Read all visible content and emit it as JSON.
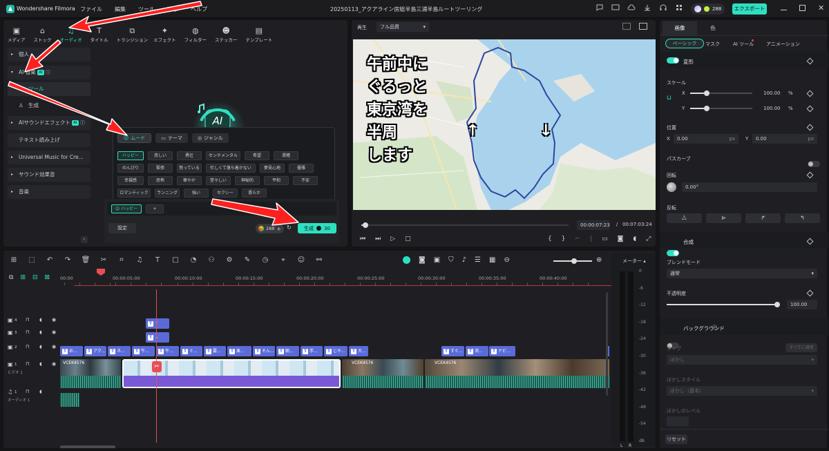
{
  "app": {
    "name": "Wondershare Filmora",
    "project_title": "20250113_アクアライン房総半島三浦半島ルートツーリング"
  },
  "menu": [
    "ファイル",
    "編集",
    "ツール",
    "表示",
    "ヘルプ"
  ],
  "topright": {
    "credits": "288",
    "export_label": "エクスポート"
  },
  "media_tabs": [
    {
      "label": "メディア",
      "icon": "media-icon"
    },
    {
      "label": "ストック",
      "icon": "stock-icon"
    },
    {
      "label": "オーディオ",
      "icon": "audio-note-icon"
    },
    {
      "label": "タイトル",
      "icon": "title-icon"
    },
    {
      "label": "トランジション",
      "icon": "transition-icon"
    },
    {
      "label": "エフェクト",
      "icon": "effect-icon"
    },
    {
      "label": "フィルター",
      "icon": "filter-icon"
    },
    {
      "label": "ステッカー",
      "icon": "sticker-icon"
    },
    {
      "label": "テンプレート",
      "icon": "template-icon"
    }
  ],
  "sidebar": {
    "personal": "個人",
    "ai_music": "AI 音楽",
    "ai_badge": "AI",
    "tool": "ツール",
    "generate": "生成",
    "ai_sound": "AIサウンドエフェクト",
    "tts": "テキスト読み上げ",
    "universal": "Universal Music for Cre...",
    "sound_fx": "サウンド効果音",
    "music": "音楽"
  },
  "ai_panel": {
    "tabs": [
      "ムード",
      "テーマ",
      "ジャンル"
    ],
    "moods": [
      [
        "ハッピー",
        "悲しい",
        "勇壮",
        "センチメンタル",
        "希望",
        "滑稽"
      ],
      [
        "のんびり",
        "緊張",
        "怒っている",
        "忙しくて落ち着かない",
        "夢見心地",
        "優雅"
      ],
      [
        "幸福感",
        "恐怖",
        "華やか",
        "堂々しい",
        "神秘的",
        "平和",
        "不安"
      ],
      [
        "ロマンティック",
        "ランニング",
        "強い",
        "セクシー",
        "滑らか"
      ]
    ],
    "selected_tag": "ハッピー",
    "add": "+",
    "settings": "設定",
    "credits": "288",
    "generate": "生成",
    "cost": "30"
  },
  "preview": {
    "label": "再生",
    "quality": "フル品質",
    "overlay_lines": [
      "午前中に",
      "ぐるっと",
      "東京湾を",
      "半周",
      "します"
    ],
    "arrow_up": "↑",
    "arrow_down": "↓",
    "current_time": "00:00:07:23",
    "total_time": "00:07:03:24",
    "separator": "/",
    "progress_fraction": 0.019
  },
  "inspector": {
    "tabs": [
      "画像",
      "色"
    ],
    "subtabs": [
      "ベーシック",
      "マスク",
      "AI ツール",
      "アニメーション"
    ],
    "transform": "変形",
    "scale": "スケール",
    "x_label": "X",
    "y_label": "Y",
    "scale_x": "100.00",
    "scale_y": "100.00",
    "percent": "%",
    "position": "位置",
    "pos_x": "0.00",
    "pos_y": "0.00",
    "px": "px",
    "path_curve": "パスカーブ",
    "rotate": "回転",
    "rotate_val": "0.00°",
    "flip": "反転",
    "composite": "合成",
    "blend_mode": "ブレンドモード",
    "blend_val": "通常",
    "opacity": "不透明度",
    "opacity_val": "100.00",
    "background": "バックグラウンド",
    "type": "タイプ",
    "apply_all": "すべてに適用",
    "blur": "ぼかし",
    "blur_style": "ぼかしスタイル",
    "blur_style_val": "ぼかし（基本）",
    "blur_level": "ぼかしのレベル",
    "reset": "リセット"
  },
  "timeline": {
    "ruler": [
      "00:00",
      "00:00:05:00",
      "00:00:10:00",
      "00:00:15:00",
      "00:00:20:00",
      "00:00:25:00",
      "00:00:30:00",
      "00:00:35:00",
      "00:00:40:00"
    ],
    "meter_label": "メーター",
    "meter_scale": [
      "0",
      "-6",
      "-12",
      "-18",
      "-24",
      "-30",
      "-36",
      "-42",
      "-48",
      "-54",
      "dB"
    ],
    "meter_lr": [
      "L",
      "R"
    ],
    "tracks": [
      {
        "num": "4",
        "name": ""
      },
      {
        "num": "3",
        "name": ""
      },
      {
        "num": "2",
        "name": ""
      },
      {
        "num": "1",
        "name": "ビデオ 1"
      },
      {
        "num": "1",
        "name": "オーディオ 1"
      }
    ],
    "track4_clip": "↑",
    "track3_clip": "↓",
    "title_clips": [
      "お...",
      "アク...",
      "ネ...",
      "午...",
      "午...",
      "ぐ...",
      "要...",
      "東...",
      "そん...",
      "朝...",
      "手...",
      "じや...",
      "大...",
      "すぐ...",
      "消...",
      "ナビ..."
    ],
    "video_clips": [
      "VCEK4576",
      "VCEK4576",
      "VCEK4576",
      "VCEK4576"
    ]
  }
}
